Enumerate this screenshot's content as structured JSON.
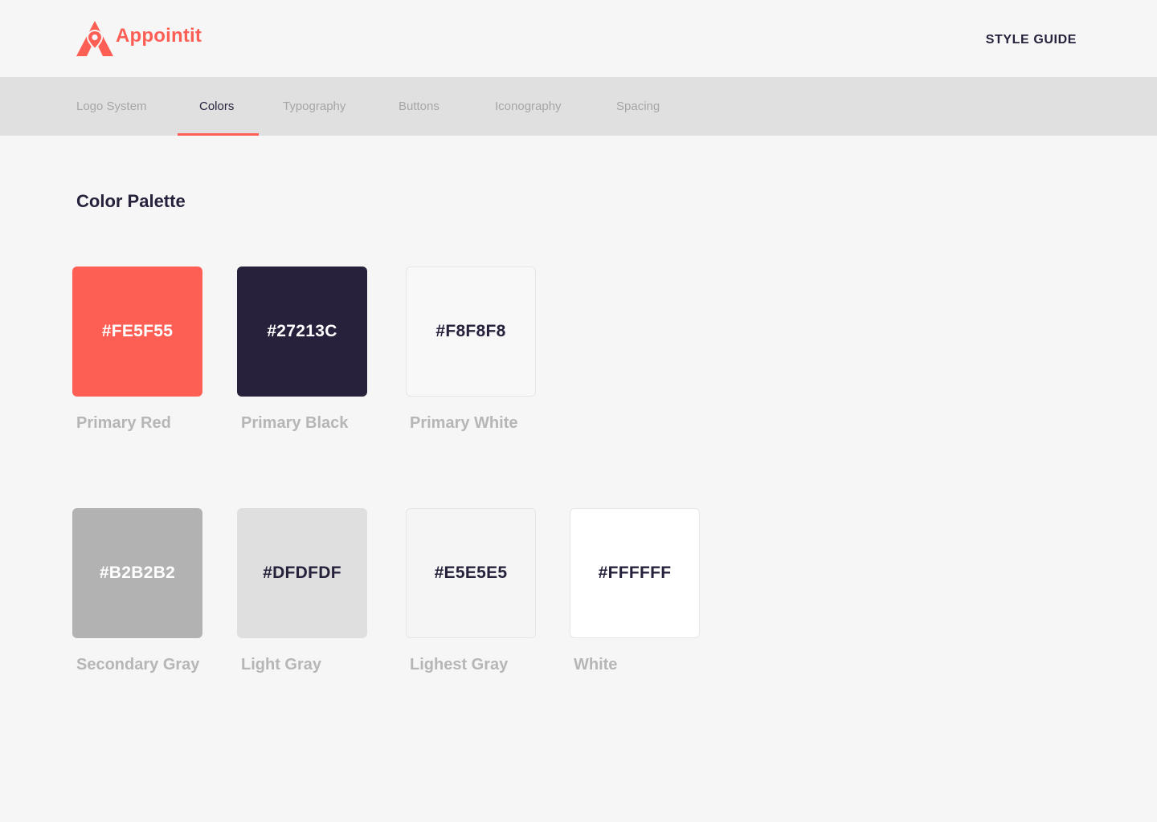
{
  "brand": {
    "name": "Appointit",
    "logo_icon": "map-pin-letter-a-icon",
    "accent_color": "#FE5F55"
  },
  "header": {
    "link": "STYLE GUIDE"
  },
  "tabs": [
    {
      "label": "Logo System",
      "active": false
    },
    {
      "label": "Colors",
      "active": true
    },
    {
      "label": "Typography",
      "active": false
    },
    {
      "label": "Buttons",
      "active": false
    },
    {
      "label": "Iconography",
      "active": false
    },
    {
      "label": "Spacing",
      "active": false
    }
  ],
  "section": {
    "title": "Color Palette"
  },
  "palette": [
    {
      "hex": "#FE5F55",
      "name": "Primary Red",
      "color": "#FE5F55",
      "text_color": "#FFFFFF"
    },
    {
      "hex": "#27213C",
      "name": "Primary Black",
      "color": "#27213C",
      "text_color": "#FFFFFF"
    },
    {
      "hex": "#F8F8F8",
      "name": "Primary White",
      "color": "#F8F8F8",
      "text_color": "#27213C"
    },
    {
      "hex": "#B2B2B2",
      "name": "Secondary Gray",
      "color": "#B2B2B2",
      "text_color": "#FFFFFF"
    },
    {
      "hex": "#DFDFDF",
      "name": "Light Gray",
      "color": "#DFDFDF",
      "text_color": "#27213C"
    },
    {
      "hex": "#E5E5E5",
      "name": "Lighest Gray",
      "color": "#F5F5F5",
      "text_color": "#27213C"
    },
    {
      "hex": "#FFFFFF",
      "name": "White",
      "color": "#FFFFFF",
      "text_color": "#27213C"
    }
  ],
  "colors": {
    "background": "#F6F6F6",
    "tabbar": "#E0E0E0",
    "tab_inactive": "#A6A6A6",
    "text_dark": "#27213C",
    "label_gray": "#B6B6B6"
  }
}
